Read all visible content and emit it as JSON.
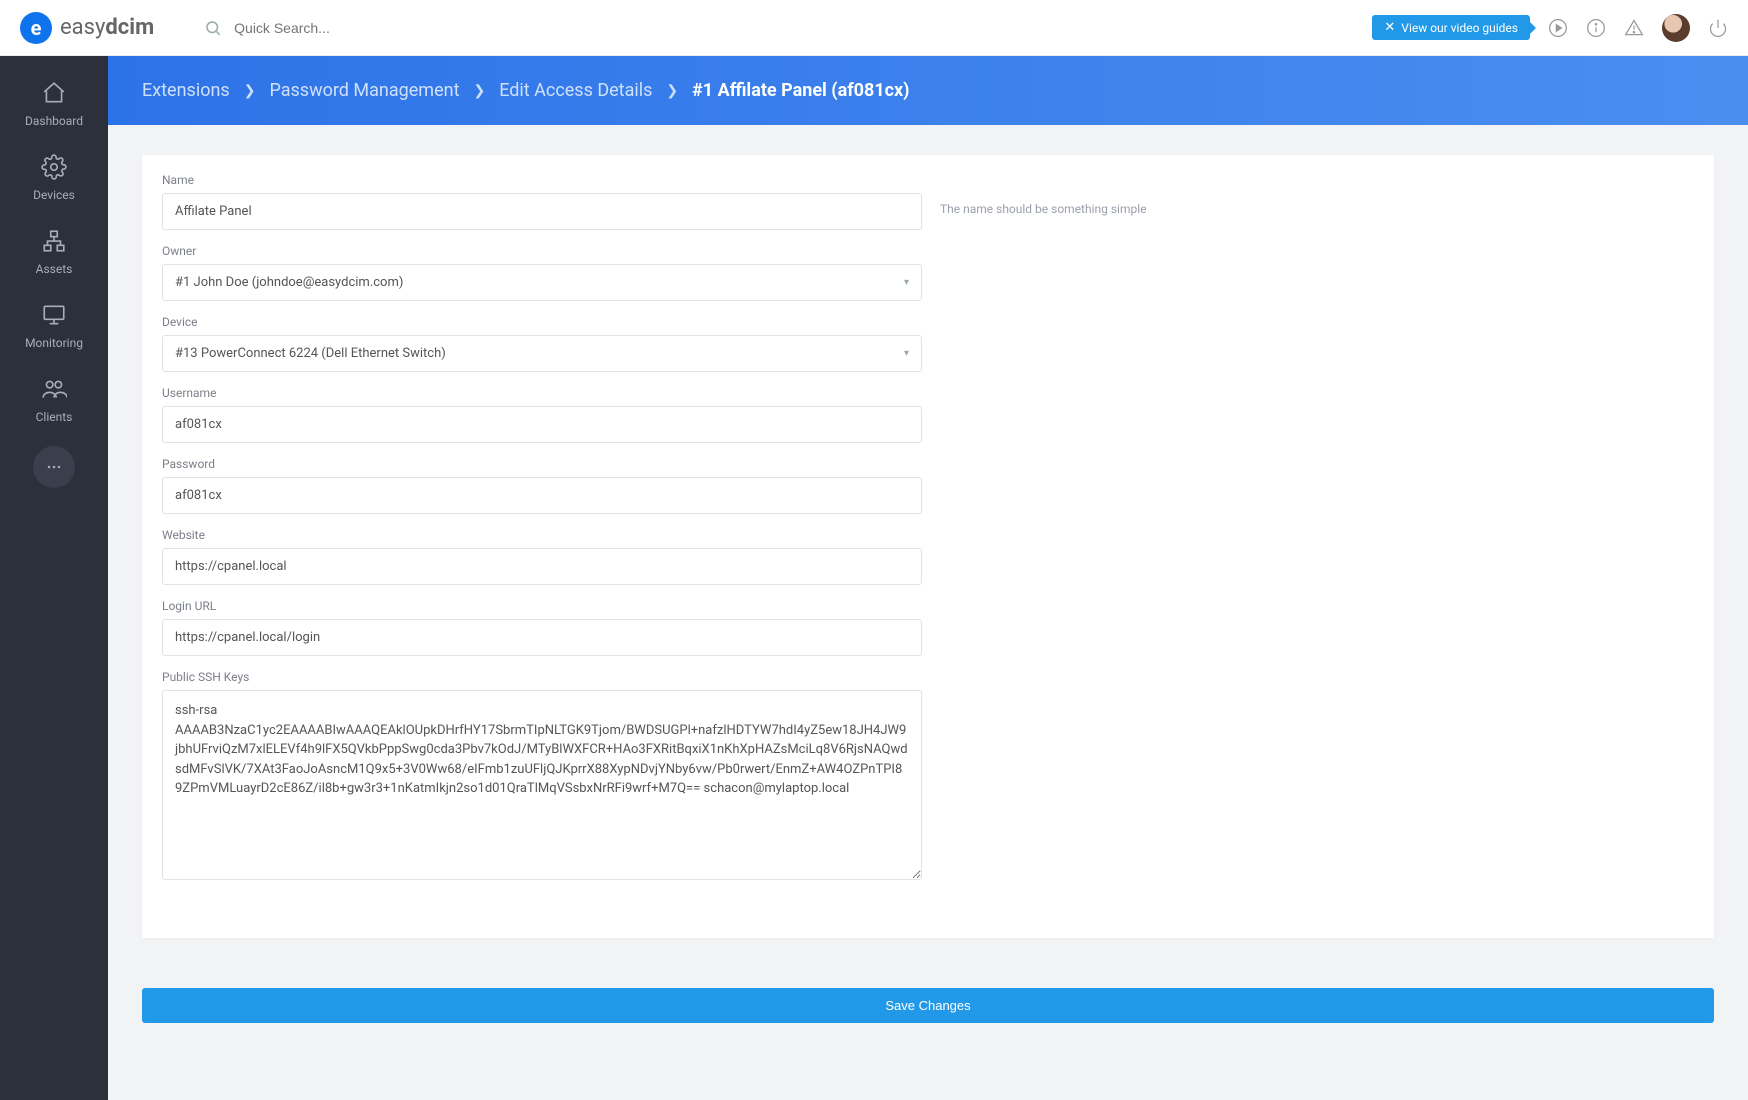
{
  "topbar": {
    "logo_easy": "easy",
    "logo_dcim": "dcim",
    "search_placeholder": "Quick Search...",
    "video_guides": "View our video guides"
  },
  "sidebar": {
    "items": [
      {
        "label": "Dashboard"
      },
      {
        "label": "Devices"
      },
      {
        "label": "Assets"
      },
      {
        "label": "Monitoring"
      },
      {
        "label": "Clients"
      }
    ]
  },
  "breadcrumb": {
    "items": [
      "Extensions",
      "Password Management",
      "Edit Access Details"
    ],
    "current": "#1 Affilate Panel (af081cx)"
  },
  "form": {
    "name_label": "Name",
    "name_value": "Affilate Panel",
    "name_hint": "The name should be something simple",
    "owner_label": "Owner",
    "owner_value": "#1 John Doe (johndoe@easydcim.com)",
    "device_label": "Device",
    "device_value": "#13 PowerConnect 6224 (Dell Ethernet Switch)",
    "username_label": "Username",
    "username_value": "af081cx",
    "password_label": "Password",
    "password_value": "af081cx",
    "website_label": "Website",
    "website_value": "https://cpanel.local",
    "loginurl_label": "Login URL",
    "loginurl_value": "https://cpanel.local/login",
    "ssh_label": "Public SSH Keys",
    "ssh_value": "ssh-rsa AAAAB3NzaC1yc2EAAAABIwAAAQEAklOUpkDHrfHY17SbrmTIpNLTGK9Tjom/BWDSUGPl+nafzlHDTYW7hdI4yZ5ew18JH4JW9jbhUFrviQzM7xlELEVf4h9lFX5QVkbPppSwg0cda3Pbv7kOdJ/MTyBlWXFCR+HAo3FXRitBqxiX1nKhXpHAZsMciLq8V6RjsNAQwdsdMFvSlVK/7XAt3FaoJoAsncM1Q9x5+3V0Ww68/eIFmb1zuUFljQJKprrX88XypNDvjYNby6vw/Pb0rwert/EnmZ+AW4OZPnTPI89ZPmVMLuayrD2cE86Z/il8b+gw3r3+1nKatmIkjn2so1d01QraTlMqVSsbxNrRFi9wrf+M7Q== schacon@mylaptop.local"
  },
  "actions": {
    "save": "Save Changes"
  }
}
